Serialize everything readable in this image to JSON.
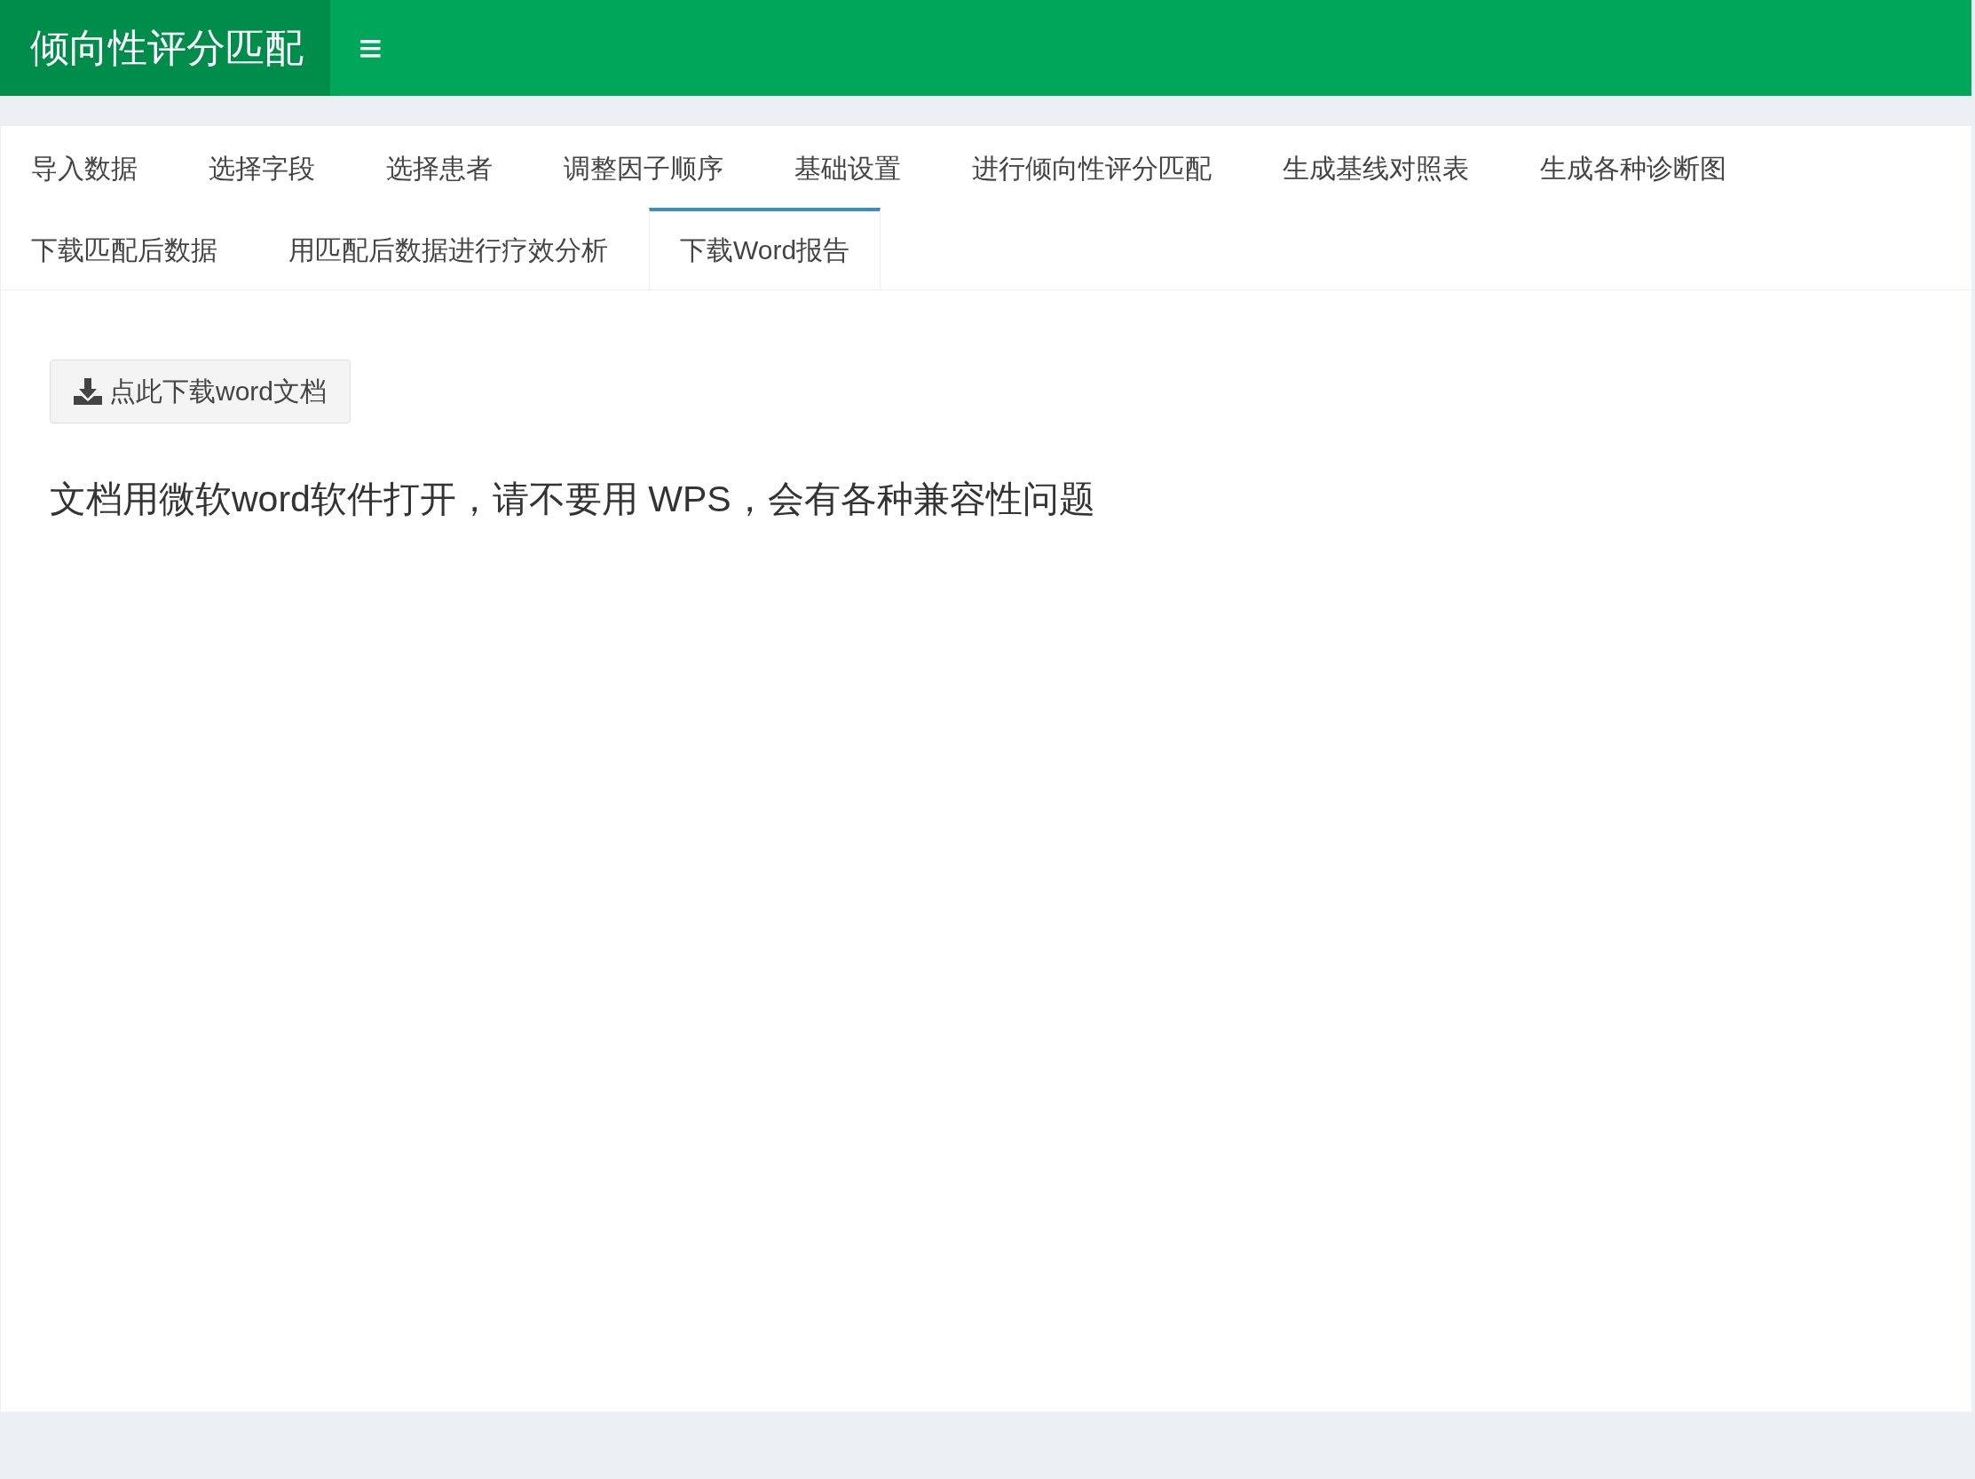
{
  "header": {
    "title": "倾向性评分匹配",
    "menu_toggle": "≡"
  },
  "tabs": [
    {
      "label": "导入数据",
      "selected": false
    },
    {
      "label": "选择字段",
      "selected": false
    },
    {
      "label": "选择患者",
      "selected": false
    },
    {
      "label": "调整因子顺序",
      "selected": false
    },
    {
      "label": "基础设置",
      "selected": false
    },
    {
      "label": "进行倾向性评分匹配",
      "selected": false
    },
    {
      "label": "生成基线对照表",
      "selected": false
    },
    {
      "label": "生成各种诊断图",
      "selected": false
    },
    {
      "label": "下载匹配后数据",
      "selected": false
    },
    {
      "label": "用匹配后数据进行疗效分析",
      "selected": false
    },
    {
      "label": "下载Word报告",
      "selected": true
    }
  ],
  "download_button": {
    "label": "点此下载word文档"
  },
  "notice": "文档用微软word软件打开，请不要用 WPS，会有各种兼容性问题"
}
